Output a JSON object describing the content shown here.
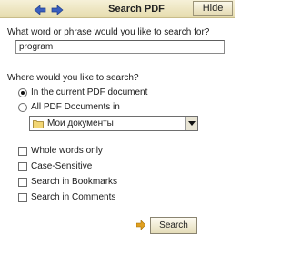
{
  "window": {
    "title": "Search PDF",
    "hide_label": "Hide",
    "back_icon": "arrow-left-icon",
    "forward_icon": "arrow-right-icon"
  },
  "query": {
    "label": "What word or phrase would you like to search for?",
    "value": "program"
  },
  "location": {
    "label": "Where would you like to search?",
    "options": [
      {
        "label": "In the current PDF document",
        "checked": true
      },
      {
        "label": "All PDF Documents in",
        "checked": false
      }
    ],
    "folder": {
      "icon": "folder-icon",
      "value": "Мои документы"
    }
  },
  "options": [
    {
      "label": "Whole words only",
      "checked": false
    },
    {
      "label": "Case-Sensitive",
      "checked": false
    },
    {
      "label": "Search in Bookmarks",
      "checked": false
    },
    {
      "label": "Search in Comments",
      "checked": false
    }
  ],
  "search_button": {
    "label": "Search",
    "icon": "arrow-right-icon"
  },
  "colors": {
    "accent": "#e0a020",
    "nav_arrow": "#3a5fbf",
    "title_bar": "#ede4bd"
  }
}
